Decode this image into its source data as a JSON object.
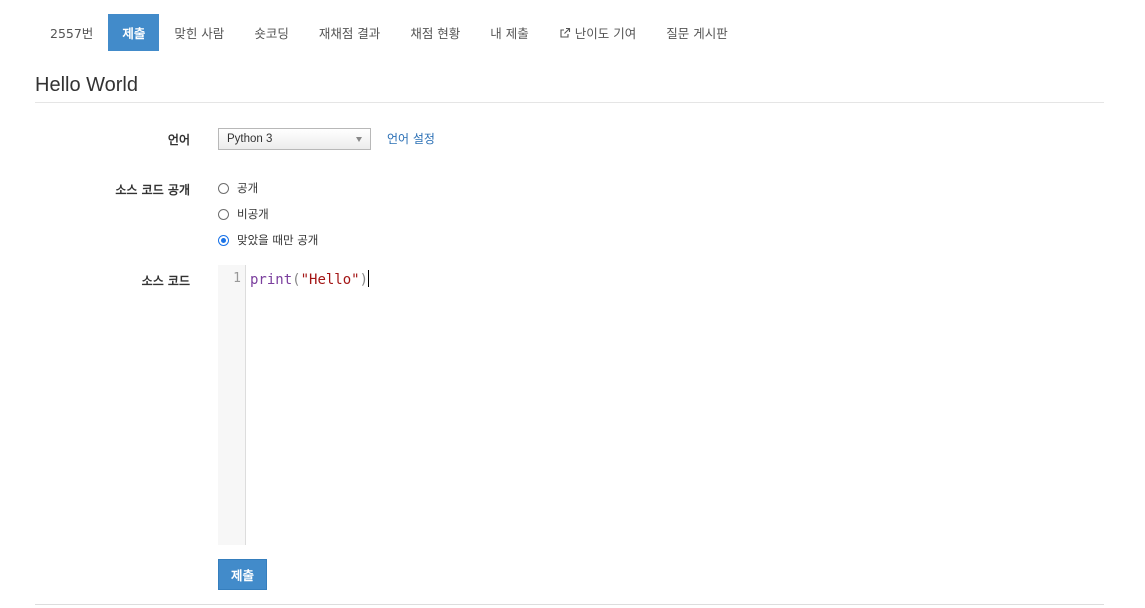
{
  "nav": {
    "items": [
      {
        "label": "2557번",
        "active": false
      },
      {
        "label": "제출",
        "active": true
      },
      {
        "label": "맞힌 사람",
        "active": false
      },
      {
        "label": "숏코딩",
        "active": false
      },
      {
        "label": "재채점 결과",
        "active": false
      },
      {
        "label": "채점 현황",
        "active": false
      },
      {
        "label": "내 제출",
        "active": false
      },
      {
        "label": "난이도 기여",
        "active": false,
        "icon": "external-link-icon"
      },
      {
        "label": "질문 게시판",
        "active": false
      }
    ]
  },
  "problem": {
    "title": "Hello World"
  },
  "form": {
    "language_label": "언어",
    "language_value": "Python 3",
    "language_settings_link": "언어 설정",
    "visibility_label": "소스 코드 공개",
    "visibility_options": [
      {
        "label": "공개",
        "checked": false
      },
      {
        "label": "비공개",
        "checked": false
      },
      {
        "label": "맞았을 때만 공개",
        "checked": true
      }
    ],
    "code_label": "소스 코드",
    "code": {
      "line_number": "1",
      "builtin": "print",
      "open_paren": "(",
      "string": "\"Hello\"",
      "close_paren": ")"
    },
    "submit_label": "제출"
  },
  "colors": {
    "accent": "#428bca",
    "link": "#2a6fb5"
  }
}
